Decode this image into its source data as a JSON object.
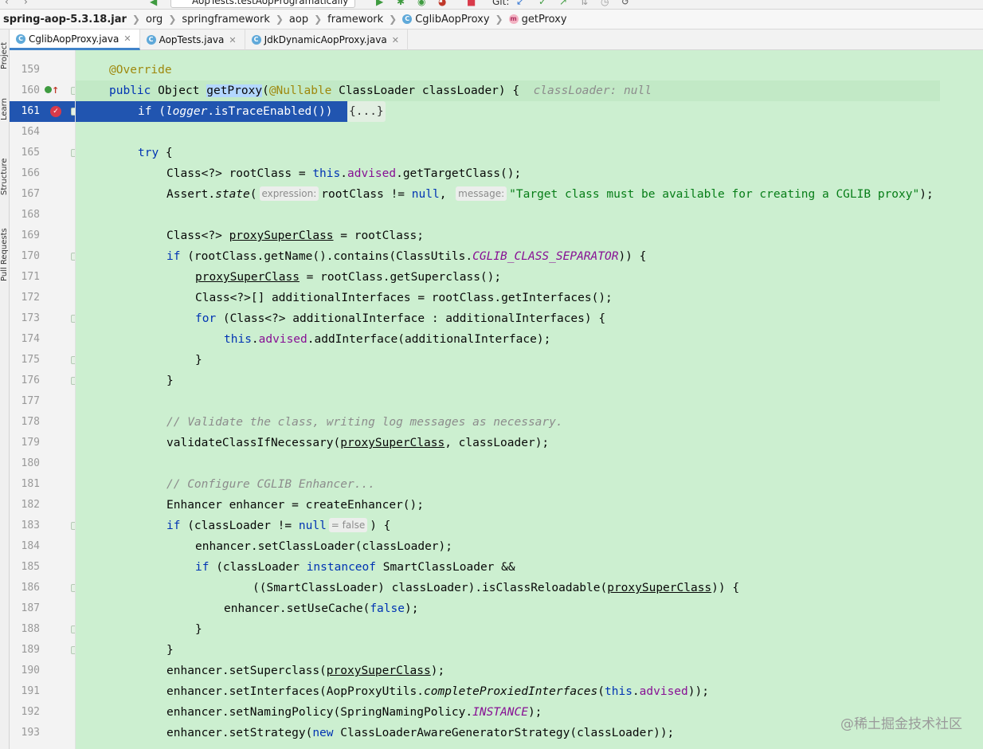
{
  "navbar": {
    "run_config": "AopTests.testAopProgramatically",
    "git_label": "Git:"
  },
  "breadcrumb": {
    "jar": "spring-aop-5.3.18.jar",
    "items": [
      "org",
      "springframework",
      "aop",
      "framework"
    ],
    "class_name": "CglibAopProxy",
    "method_name": "getProxy"
  },
  "toolstripe": {
    "tabs": [
      "Project",
      "Learn",
      "Structure",
      "Pull Requests"
    ]
  },
  "tabs": [
    {
      "label": "CglibAopProxy.java",
      "active": true
    },
    {
      "label": "AopTests.java",
      "active": false
    },
    {
      "label": "JdkDynamicAopProxy.java",
      "active": false
    }
  ],
  "editor": {
    "line_numbers": [
      "159",
      "160",
      "161",
      "164",
      "165",
      "166",
      "167",
      "168",
      "169",
      "170",
      "171",
      "172",
      "173",
      "174",
      "175",
      "176",
      "177",
      "178",
      "179",
      "180",
      "181",
      "182",
      "183",
      "184",
      "185",
      "186",
      "187",
      "188",
      "189",
      "190",
      "191",
      "192",
      "193"
    ],
    "texts": {
      "l159": "@Override",
      "l160_a": "public",
      "l160_b": " Object ",
      "l160_c": "getProxy",
      "l160_d": "(",
      "l160_e": "@Nullable",
      "l160_f": " ClassLoader classLoader) {",
      "l160_hint": "classLoader: null",
      "l161_a": "if",
      "l161_b": " (",
      "l161_c": "logger",
      "l161_d": ".",
      "l161_e": "isTraceEnabled",
      "l161_f": "())",
      "l161_fold": "{...}",
      "l165": "try",
      "l165_b": " {",
      "l166_a": "Class<?> rootClass = ",
      "l166_b": "this",
      "l166_c": ".",
      "l166_d": "advised",
      "l166_e": ".getTargetClass();",
      "l167_a": "Assert.",
      "l167_b": "state",
      "l167_c": "(",
      "l167_hint1": "expression:",
      "l167_d": "rootClass != ",
      "l167_e": "null",
      "l167_f": ",",
      "l167_hint2": "message:",
      "l167_g": "\"Target class must be available for creating a CGLIB proxy\"",
      "l167_h": ");",
      "l169_a": "Class<?> ",
      "l169_b": "proxySuperClass",
      "l169_c": " = rootClass;",
      "l170_a": "if",
      "l170_b": " (rootClass.getName().contains(ClassUtils.",
      "l170_c": "CGLIB_CLASS_SEPARATOR",
      "l170_d": ")) {",
      "l171_a": "proxySuperClass",
      "l171_b": " = rootClass.getSuperclass();",
      "l172": "Class<?>[] additionalInterfaces = rootClass.getInterfaces();",
      "l173_a": "for",
      "l173_b": " (Class<?> additionalInterface : additionalInterfaces) {",
      "l174_a": "this",
      "l174_b": ".",
      "l174_c": "advised",
      "l174_d": ".addInterface(additionalInterface);",
      "l175": "}",
      "l176": "}",
      "l178": "// Validate the class, writing log messages as necessary.",
      "l179_a": "validateClassIfNecessary(",
      "l179_b": "proxySuperClass",
      "l179_c": ", classLoader);",
      "l181": "// Configure CGLIB Enhancer...",
      "l182": "Enhancer enhancer = createEnhancer();",
      "l183_a": "if",
      "l183_b": " (classLoader != ",
      "l183_c": "null",
      "l183_hint": "= false",
      "l183_d": ") {",
      "l184": "enhancer.setClassLoader(classLoader);",
      "l185_a": "if",
      "l185_b": " (classLoader ",
      "l185_c": "instanceof",
      "l185_d": " SmartClassLoader &&",
      "l186_a": "((SmartClassLoader) classLoader).isClassReloadable(",
      "l186_b": "proxySuperClass",
      "l186_c": ")) {",
      "l187_a": "enhancer.setUseCache(",
      "l187_b": "false",
      "l187_c": ");",
      "l188": "}",
      "l189": "}",
      "l190_a": "enhancer.setSuperclass(",
      "l190_b": "proxySuperClass",
      "l190_c": ");",
      "l191_a": "enhancer.setInterfaces(AopProxyUtils.",
      "l191_b": "completeProxiedInterfaces",
      "l191_c": "(",
      "l191_d": "this",
      "l191_e": ".",
      "l191_f": "advised",
      "l191_g": "));",
      "l192_a": "enhancer.setNamingPolicy(SpringNamingPolicy.",
      "l192_b": "INSTANCE",
      "l192_c": ");",
      "l193_a": "enhancer.setStrategy(",
      "l193_b": "new",
      "l193_c": " ClassLoaderAwareGeneratorStrategy(classLoader));"
    }
  },
  "watermark": "@稀土掘金技术社区",
  "colors": {
    "editor_bg": "#ccefd0",
    "current_line": "#2155b0",
    "keyword": "#0033b3",
    "annotation": "#9e880d",
    "field": "#871094",
    "string": "#067d17",
    "comment": "#8c8c8c"
  }
}
